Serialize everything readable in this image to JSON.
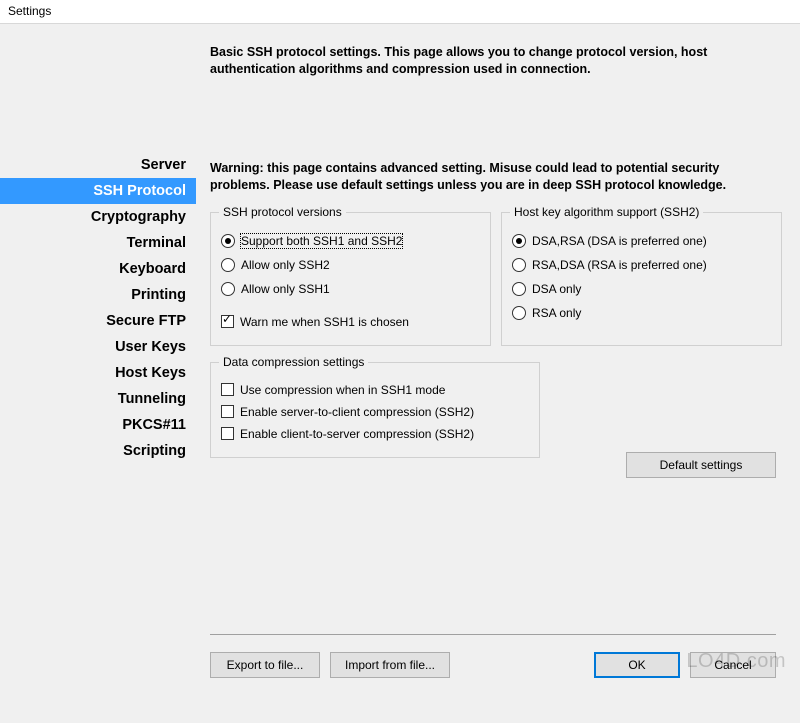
{
  "window": {
    "title": "Settings"
  },
  "sidebar": {
    "items": [
      {
        "label": "Server"
      },
      {
        "label": "SSH Protocol"
      },
      {
        "label": "Cryptography"
      },
      {
        "label": "Terminal"
      },
      {
        "label": "Keyboard"
      },
      {
        "label": "Printing"
      },
      {
        "label": "Secure FTP"
      },
      {
        "label": "User Keys"
      },
      {
        "label": "Host Keys"
      },
      {
        "label": "Tunneling"
      },
      {
        "label": "PKCS#11"
      },
      {
        "label": "Scripting"
      }
    ],
    "selected_index": 1
  },
  "main": {
    "description": "Basic SSH protocol settings. This page allows you to change protocol version, host authentication algorithms and compression used in connection.",
    "warning": "Warning: this page contains advanced setting. Misuse could lead to potential security problems. Please use default settings unless you are in deep SSH protocol knowledge.",
    "group_versions": {
      "title": "SSH protocol versions",
      "options": [
        "Support both SSH1 and SSH2",
        "Allow only SSH2",
        "Allow only SSH1"
      ],
      "selected_index": 0,
      "warn_ssh1_label": "Warn me when SSH1 is chosen",
      "warn_ssh1_checked": true
    },
    "group_hostkey": {
      "title": "Host key algorithm support (SSH2)",
      "options": [
        "DSA,RSA (DSA is preferred one)",
        "RSA,DSA (RSA is preferred one)",
        "DSA only",
        "RSA only"
      ],
      "selected_index": 0
    },
    "group_compression": {
      "title": "Data compression settings",
      "options": [
        {
          "label": "Use compression when in SSH1 mode",
          "checked": false
        },
        {
          "label": "Enable server-to-client compression (SSH2)",
          "checked": false
        },
        {
          "label": "Enable client-to-server compression (SSH2)",
          "checked": false
        }
      ]
    },
    "default_settings_label": "Default settings"
  },
  "footer": {
    "export_label": "Export to file...",
    "import_label": "Import from file...",
    "ok_label": "OK",
    "cancel_label": "Cancel"
  },
  "watermark": "LO4D.com"
}
